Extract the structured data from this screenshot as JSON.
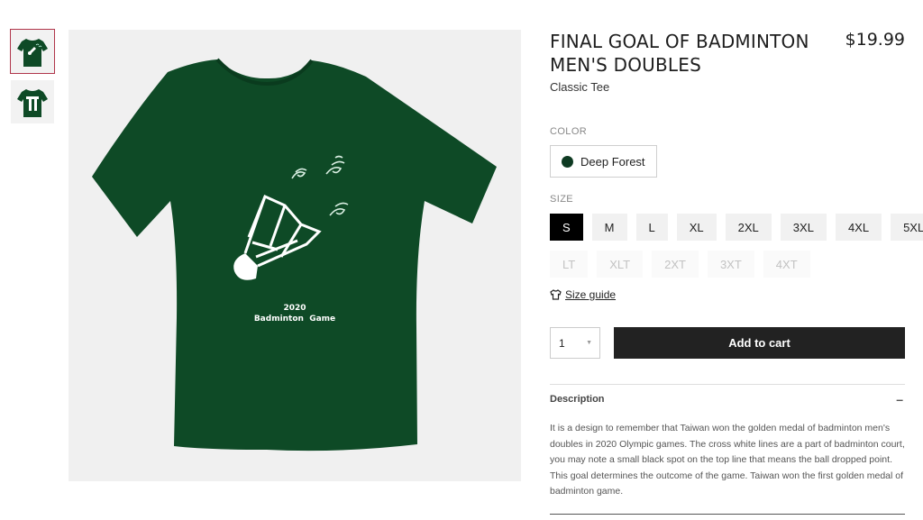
{
  "product": {
    "title": "FINAL GOAL OF BADMINTON MEN'S DOUBLES",
    "price": "$19.99",
    "subtitle": "Classic Tee",
    "shirt_color": "#0e4a26",
    "print": {
      "line1": "2020",
      "line2": "Badminton  Game"
    }
  },
  "gallery": {
    "thumbnails": [
      {
        "name": "back-view",
        "active": true
      },
      {
        "name": "front-view",
        "active": false
      }
    ]
  },
  "color": {
    "label": "COLOR",
    "selected": "Deep Forest",
    "swatch": "#0e3a22"
  },
  "size": {
    "label": "SIZE",
    "row1": [
      "S",
      "M",
      "L",
      "XL",
      "2XL",
      "3XL",
      "4XL",
      "5XL"
    ],
    "row2": [
      "LT",
      "XLT",
      "2XT",
      "3XT",
      "4XT"
    ],
    "selected": "S",
    "guide": "Size guide"
  },
  "cart": {
    "quantity": "1",
    "button": "Add to cart"
  },
  "description": {
    "heading": "Description",
    "toggle": "–",
    "body": "It is a design to remember that Taiwan won the golden medal of badminton men's doubles in 2020 Olympic games. The cross white lines are a part of badminton court, you may note a small black spot on the top line that means the ball dropped point. This goal determines the outcome of the game. Taiwan won the first golden medal of badminton game."
  },
  "colors": {
    "accent_outline": "#b0354a",
    "button_bg": "#222222"
  }
}
